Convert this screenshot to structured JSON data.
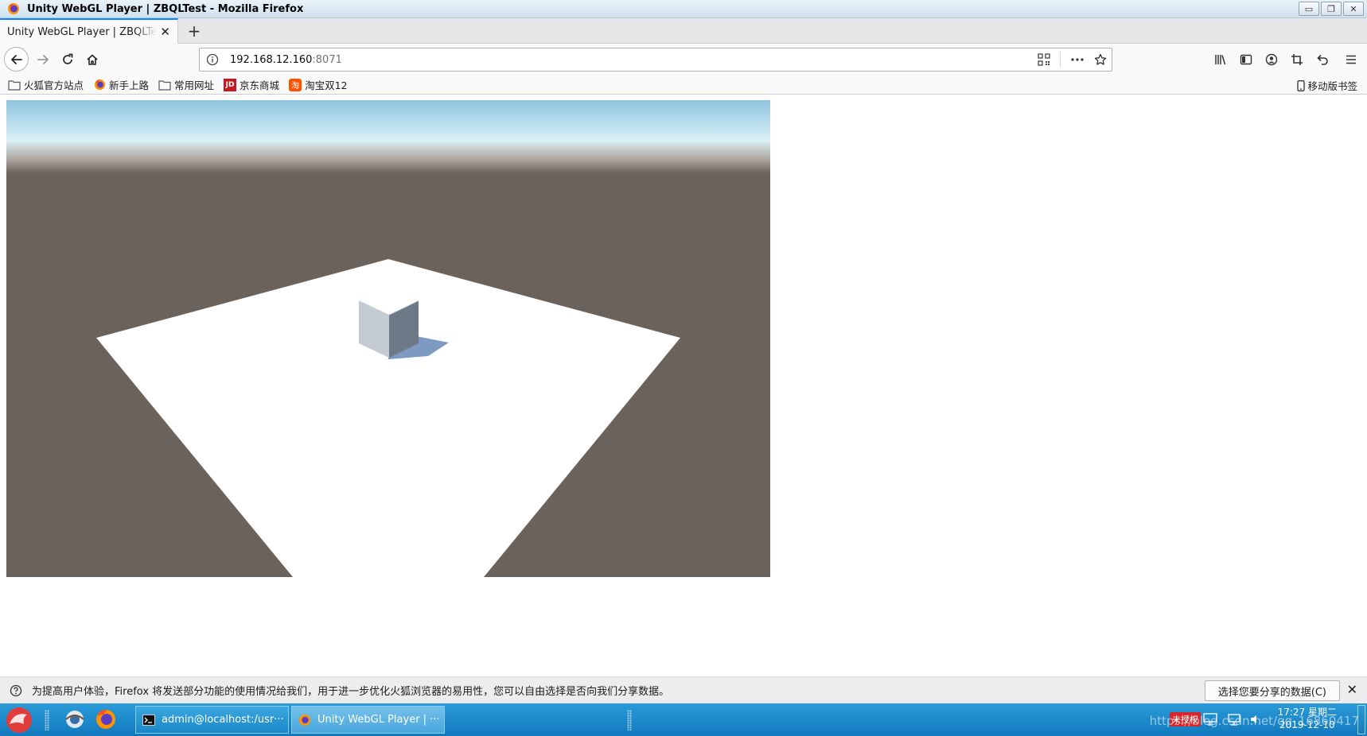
{
  "window": {
    "title": "Unity WebGL Player | ZBQLTest - Mozilla Firefox",
    "controls": {
      "minimize": "▭",
      "restore": "❐",
      "close": "✕"
    }
  },
  "tabs": [
    {
      "label": "Unity WebGL Player | ZBQLTest",
      "active": true
    }
  ],
  "newtab_label": "+",
  "urlbar": {
    "host": "192.168.12.160",
    "port": ":8071"
  },
  "bookmarks": [
    {
      "label": "火狐官方站点",
      "icon": "folder-icon"
    },
    {
      "label": "新手上路",
      "icon": "firefox-icon"
    },
    {
      "label": "常用网址",
      "icon": "folder-icon"
    },
    {
      "label": "京东商城",
      "icon": "jd-icon"
    },
    {
      "label": "淘宝双12",
      "icon": "taobao-icon"
    }
  ],
  "bookmark_icon_text": {
    "jd": "JD",
    "taobao": "淘"
  },
  "mobile_bookmarks": "移动版书签",
  "notification": {
    "text": "为提高用户体验，Firefox 将发送部分功能的使用情况给我们，用于进一步优化火狐浏览器的易用性，您可以自由选择是否向我们分享数据。",
    "button": "选择您要分享的数据(C)",
    "close": "✕"
  },
  "taskbar": {
    "tasks": [
      {
        "label": "admin@localhost:/usr···",
        "icon": "terminal-icon",
        "active": false
      },
      {
        "label": "Unity WebGL Player | ···",
        "icon": "firefox-icon",
        "active": true
      }
    ],
    "tray_badge": "未授权",
    "clock": {
      "time": "17:27 星期二",
      "date": "2019-12-10"
    },
    "watermark": "https://blog.csdn.net/qq_16860417"
  },
  "colors": {
    "accent": "#0a84ff",
    "sky_top": "#8fc3df",
    "sky_horizon": "#d9f0f5",
    "ground": "#6b625b",
    "plane": "#ffffff",
    "cube_left": "#c3cad2",
    "cube_right": "#6d7986",
    "shadow": "#7d9bc2",
    "taskbar": "#1f8fcf"
  }
}
